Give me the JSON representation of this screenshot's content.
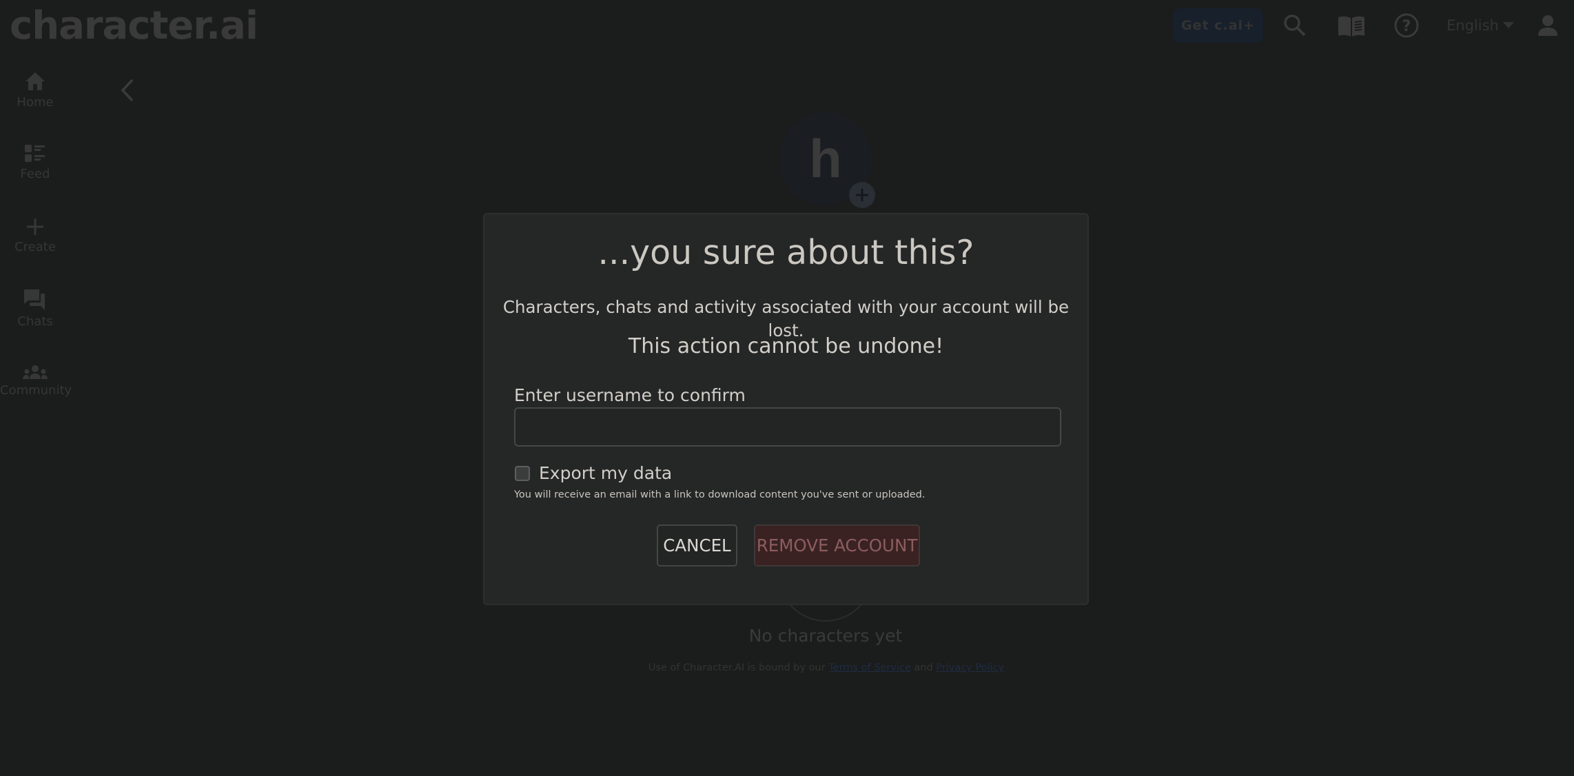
{
  "header": {
    "logo": "character.ai",
    "get_plus_label": "Get c.ai+",
    "icons": [
      "search-icon",
      "book-icon",
      "help-icon",
      "user-icon"
    ],
    "language": "English"
  },
  "sidebar": {
    "items": [
      {
        "label": "Home",
        "icon": "home-icon"
      },
      {
        "label": "Feed",
        "icon": "feed-icon"
      },
      {
        "label": "Create",
        "icon": "plus-icon"
      },
      {
        "label": "Chats",
        "icon": "chats-icon"
      },
      {
        "label": "Community",
        "icon": "community-icon"
      }
    ]
  },
  "profile": {
    "avatar_initial": "h",
    "empty_state": "No characters yet",
    "footer": {
      "prefix": "Use of Character.AI is bound by our ",
      "terms": "Terms of Service",
      "and": " and ",
      "privacy": "Privacy Policy"
    }
  },
  "modal": {
    "title": "...you sure about this?",
    "body": "Characters, chats and activity associated with your account will be lost.",
    "warning": "This action cannot be undone!",
    "username_label": "Enter username to confirm",
    "username_value": "",
    "username_placeholder": "",
    "export_label": "Export my data",
    "export_checked": false,
    "export_hint": "You will receive an email with a link to download content you've sent or uploaded.",
    "cancel_label": "CANCEL",
    "remove_label": "REMOVE ACCOUNT"
  },
  "colors": {
    "background": "#1b1c1c",
    "modal_bg": "#252626",
    "danger_bg": "#3a2222",
    "danger_text": "#8c5d5f",
    "brand_button": "#18202b"
  }
}
